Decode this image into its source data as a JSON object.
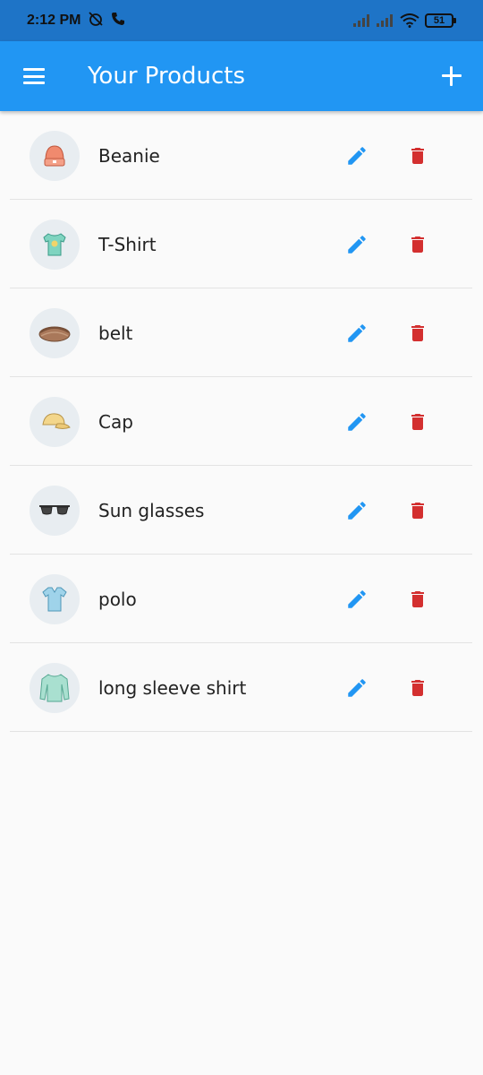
{
  "status_bar": {
    "time": "2:12 PM",
    "battery": "51"
  },
  "app_bar": {
    "title": "Your Products",
    "menu_icon": "menu-icon",
    "add_icon": "add-icon"
  },
  "products": [
    {
      "name": "Beanie",
      "thumbnail": "beanie-image"
    },
    {
      "name": "T-Shirt",
      "thumbnail": "tshirt-image"
    },
    {
      "name": "belt",
      "thumbnail": "belt-image"
    },
    {
      "name": "Cap",
      "thumbnail": "cap-image"
    },
    {
      "name": "Sun glasses",
      "thumbnail": "sunglasses-image"
    },
    {
      "name": "polo",
      "thumbnail": "polo-image"
    },
    {
      "name": "long sleeve shirt",
      "thumbnail": "long-sleeve-shirt-image"
    }
  ],
  "colors": {
    "app_bar": "#2196f3",
    "status_bar": "#1e74c7",
    "edit": "#2196f3",
    "delete": "#d32f2f",
    "background": "#fafafa"
  }
}
